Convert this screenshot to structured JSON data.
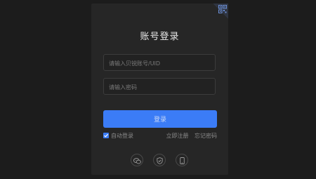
{
  "login": {
    "title": "账号登录",
    "account_placeholder": "请输入贝锐账号/UID",
    "password_placeholder": "请输入密码",
    "login_button": "登录",
    "auto_login_label": "自动登录",
    "auto_login_checked": true,
    "register_link": "立即注册",
    "forgot_link": "忘记密码"
  },
  "icons": {
    "corner": "qr-code-icon",
    "social": [
      "wechat-icon",
      "shield-icon",
      "mobile-icon"
    ]
  },
  "colors": {
    "background": "#1c1c1c",
    "panel": "#262626",
    "accent": "#3b7cf6"
  }
}
